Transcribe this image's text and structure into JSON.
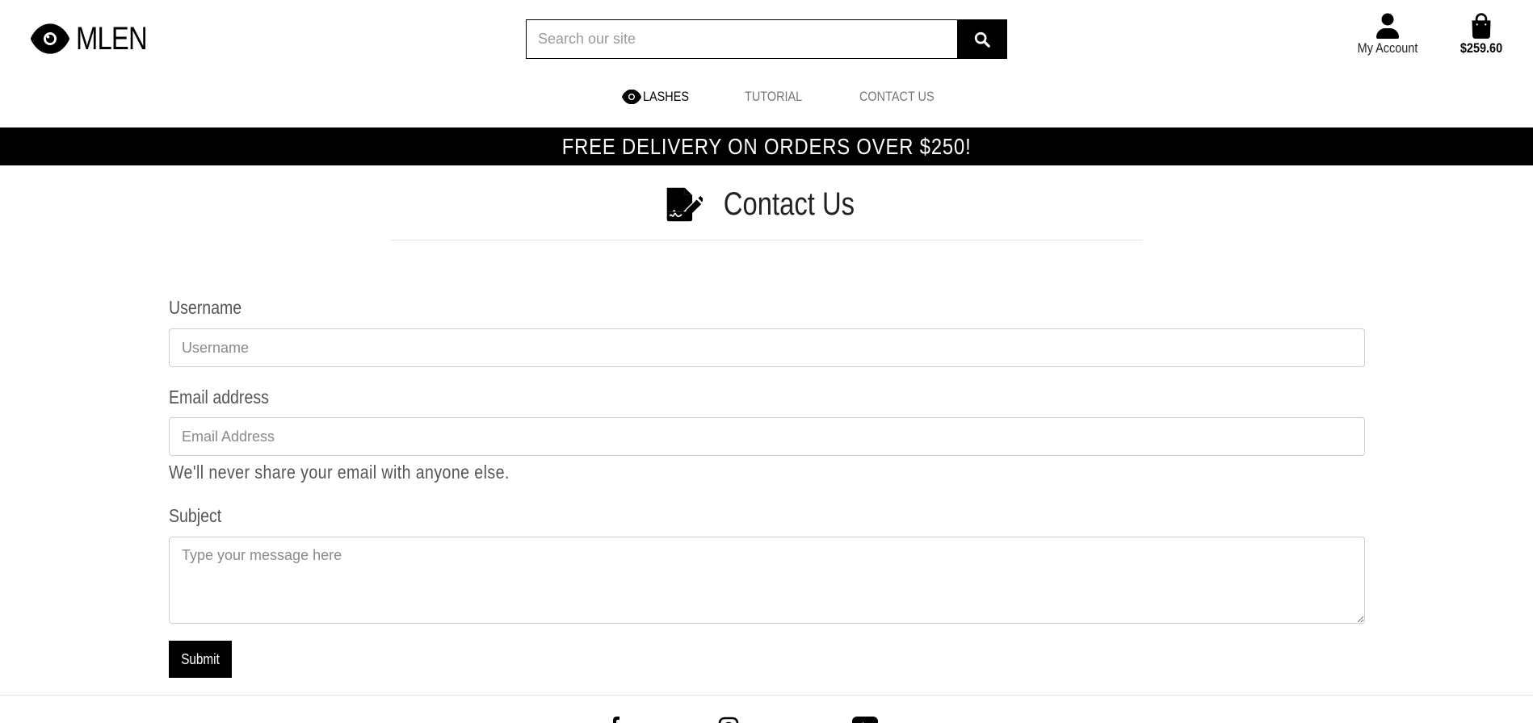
{
  "brand": {
    "name": "MLEN",
    "logo_icon": "eye-icon"
  },
  "search": {
    "placeholder": "Search our site",
    "value": "",
    "button_icon": "search-icon"
  },
  "account": {
    "label": "My Account",
    "icon": "user-icon"
  },
  "cart": {
    "total": "$259.60",
    "icon": "shopping-bag-icon"
  },
  "nav": {
    "items": [
      {
        "label": "LASHES",
        "icon": "eye-icon",
        "active": true
      },
      {
        "label": "TUTORIAL",
        "active": false
      },
      {
        "label": "CONTACT US",
        "active": false
      }
    ]
  },
  "banner": {
    "text": "FREE DELIVERY ON ORDERS OVER $250!"
  },
  "page": {
    "title": "Contact Us",
    "icon": "file-signature-icon"
  },
  "form": {
    "username": {
      "label": "Username",
      "placeholder": "Username",
      "value": ""
    },
    "email": {
      "label": "Email address",
      "placeholder": "Email Address",
      "value": "",
      "help": "We'll never share your email with anyone else."
    },
    "subject": {
      "label": "Subject",
      "placeholder": "Type your message here",
      "value": ""
    },
    "submit_label": "Submit"
  },
  "footer": {
    "social_icons": [
      "facebook-icon",
      "instagram-icon",
      "youtube-icon"
    ]
  },
  "colors": {
    "primary": "#000000",
    "background": "#ffffff",
    "muted_text": "#777777",
    "border": "#cfcfcf"
  }
}
